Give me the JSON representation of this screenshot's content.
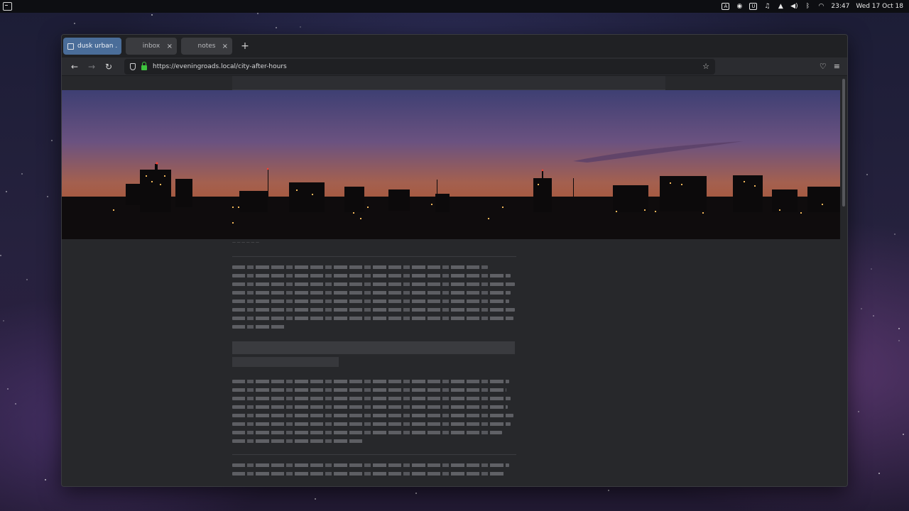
{
  "topbar": {
    "launcher_icon": "terminal-icon",
    "tray_icons": [
      "translate-icon",
      "notifications-icon",
      "clipboard-icon",
      "audio-icon",
      "volume-icon",
      "bluetooth-icon",
      "wifi-icon"
    ],
    "time": "23:47",
    "date": "Wed 17 Oct 18"
  },
  "browser": {
    "tabs": [
      {
        "label": "dusk urban ...",
        "active": true
      },
      {
        "label": "inbox",
        "active": false
      },
      {
        "label": "notes",
        "active": false
      }
    ],
    "new_tab_label": "+",
    "url": "https://eveningroads.local/city-after-hours",
    "accent_color": "#4a6d99",
    "lock_color": "#3ec43e"
  },
  "page": {
    "hero_image": "city skyline at dusk",
    "caption": "— — — — — —"
  }
}
